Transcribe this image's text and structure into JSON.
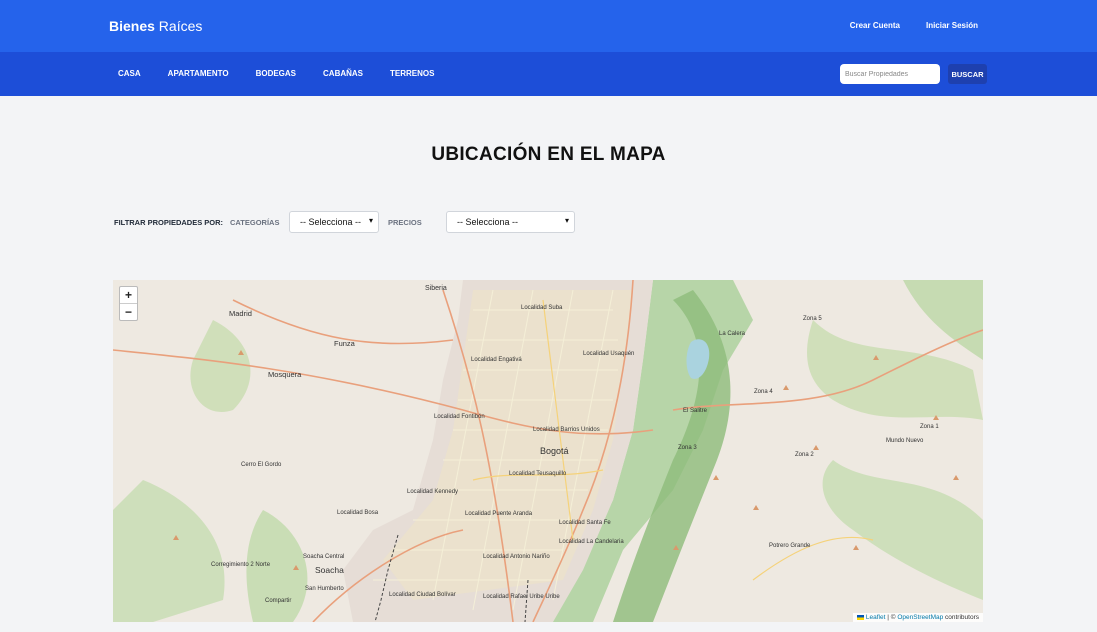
{
  "brand": {
    "bold": "Bienes",
    "rest": " Raíces"
  },
  "top_links": [
    "Crear Cuenta",
    "Iniciar Sesión"
  ],
  "categories": [
    "CASA",
    "APARTAMENTO",
    "BODEGAS",
    "CABAÑAS",
    "TERRENOS"
  ],
  "search": {
    "placeholder": "Buscar Propiedades",
    "button": "BUSCAR"
  },
  "page_title": "UBICACIÓN EN EL MAPA",
  "filters": {
    "label": "FILTRAR PROPIEDADES POR:",
    "category_label": "CATEGORÍAS",
    "category_value": "-- Selecciona --",
    "price_label": "PRECIOS",
    "price_value": "-- Selecciona --"
  },
  "map": {
    "zoom_in": "+",
    "zoom_out": "−",
    "attribution_leaflet": "Leaflet",
    "attribution_sep": " | © ",
    "attribution_osm": "OpenStreetMap",
    "attribution_rest": " contributors",
    "labels": [
      "Siberia",
      "Madrid",
      "Funza",
      "Mosquera",
      "Localidad Suba",
      "Localidad Engativá",
      "Localidad Usaquén",
      "Localidad Fontibón",
      "Bogotá",
      "Localidad Barrios Unidos",
      "Localidad Teusaquillo",
      "Localidad Kennedy",
      "Localidad Bosa",
      "Localidad Puente Aranda",
      "Localidad Santa Fe",
      "Localidad Antonio Nariño",
      "Localidad La Candelaria",
      "Soacha Central",
      "Soacha",
      "San Humberto",
      "Localidad Ciudad Bolívar",
      "Localidad Rafael Uribe Uribe",
      "La Calera",
      "Zona 5",
      "Zona 4",
      "Zona 3",
      "Zona 2",
      "Zona 1",
      "El Salitre",
      "Mundo Nuevo",
      "Potrero Grande",
      "Corregimiento 2 Norte",
      "Cerro El Gordo",
      "Compartir"
    ]
  }
}
